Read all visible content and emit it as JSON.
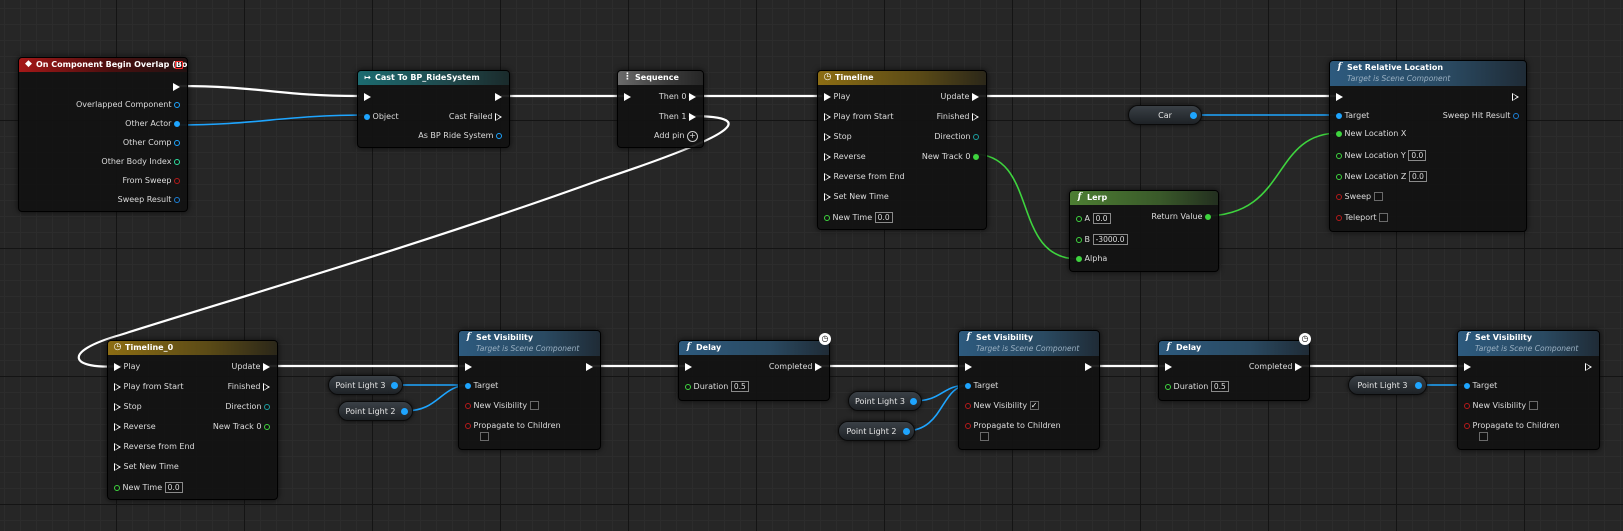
{
  "colors": {
    "exec": "#ffffff",
    "object": "#1ea5ff",
    "float": "#3ed43e",
    "bool": "#b51a1a",
    "struct": "#1c7fd6"
  },
  "nodes": {
    "begin_overlap": {
      "title": "On Component Begin Overlap (Box)",
      "pins": [
        "Overlapped Component",
        "Other Actor",
        "Other Comp",
        "Other Body Index",
        "From Sweep",
        "Sweep Result"
      ]
    },
    "cast": {
      "title": "Cast To BP_RideSystem",
      "object": "Object",
      "cast_failed": "Cast Failed",
      "as_bp": "As BP Ride System"
    },
    "sequence": {
      "title": "Sequence",
      "then0": "Then 0",
      "then1": "Then 1",
      "add_pin": "Add pin"
    },
    "timeline": {
      "title": "Timeline",
      "inputs": [
        "Play",
        "Play from Start",
        "Stop",
        "Reverse",
        "Reverse from End",
        "Set New Time",
        "New Time"
      ],
      "outputs": [
        "Update",
        "Finished",
        "Direction",
        "New Track 0"
      ],
      "new_time": "0.0"
    },
    "set_rel_loc": {
      "title": "Set Relative Location",
      "subtitle": "Target is Scene Component",
      "target": "Target",
      "sweep_hit": "Sweep Hit Result",
      "x": "New Location X",
      "y": "New Location Y",
      "z": "New Location Z",
      "y_val": "0.0",
      "z_val": "0.0",
      "sweep": "Sweep",
      "teleport": "Teleport"
    },
    "lerp": {
      "title": "Lerp",
      "a": "A",
      "a_val": "0.0",
      "b": "B",
      "b_val": "-3000.0",
      "alpha": "Alpha",
      "ret": "Return Value"
    },
    "car_var": {
      "label": "Car"
    },
    "timeline0": {
      "title": "Timeline_0",
      "inputs": [
        "Play",
        "Play from Start",
        "Stop",
        "Reverse",
        "Reverse from End",
        "Set New Time",
        "New Time"
      ],
      "outputs": [
        "Update",
        "Finished",
        "Direction",
        "New Track 0"
      ],
      "new_time": "0.0"
    },
    "vis1": {
      "title": "Set Visibility",
      "subtitle": "Target is Scene Component",
      "target": "Target",
      "new_vis": "New Visibility",
      "propagate": "Propagate to Children",
      "checked": false
    },
    "vis2": {
      "title": "Set Visibility",
      "subtitle": "Target is Scene Component",
      "target": "Target",
      "new_vis": "New Visibility",
      "propagate": "Propagate to Children",
      "checked": true
    },
    "vis3": {
      "title": "Set Visibility",
      "subtitle": "Target is Scene Component",
      "target": "Target",
      "new_vis": "New Visibility",
      "propagate": "Propagate to Children",
      "checked": false
    },
    "delay1": {
      "title": "Delay",
      "duration": "Duration",
      "duration_val": "0.5",
      "completed": "Completed"
    },
    "delay2": {
      "title": "Delay",
      "duration": "Duration",
      "duration_val": "0.5",
      "completed": "Completed"
    },
    "pl3_a": {
      "label": "Point Light 3"
    },
    "pl2_a": {
      "label": "Point Light 2"
    },
    "pl3_b": {
      "label": "Point Light 3"
    },
    "pl2_b": {
      "label": "Point Light 2"
    },
    "pl3_c": {
      "label": "Point Light 3"
    }
  },
  "icons": {
    "event": "event-diamond-icon",
    "cast": "cast-arrow-icon",
    "sequence": "sequence-icon",
    "timeline": "clock-icon",
    "function": "function-icon",
    "delay": "latent-clock-icon"
  }
}
